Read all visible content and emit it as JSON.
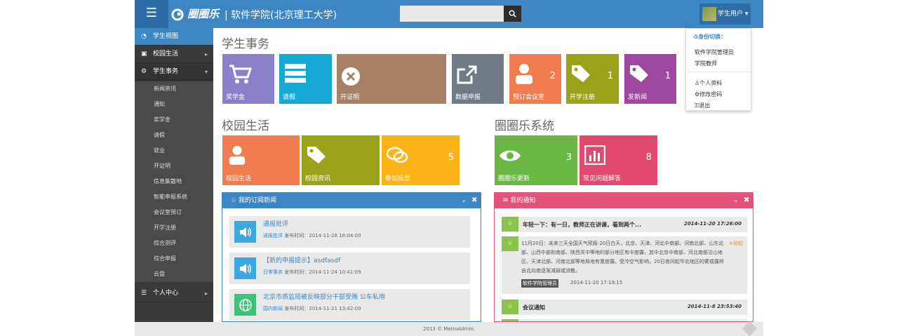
{
  "header": {
    "menu_icon": "☰",
    "logo_text": "圈圈乐",
    "site_title": "| 软件学院(北京理工大学)",
    "search_placeholder": "",
    "search_icon": "search-icon",
    "user_label": "学生用户",
    "user_caret": "▾"
  },
  "dropdown": {
    "heading": "♻身份切换：",
    "role_admin": "软件学院管理员",
    "role_teacher": "学院教师",
    "profile": "个人资料",
    "password": "修改密码",
    "logout": "退出"
  },
  "sidebar": {
    "items": [
      {
        "label": "学生视图",
        "icon": "dashboard-icon"
      },
      {
        "label": "校园生活",
        "icon": "book-icon"
      },
      {
        "label": "学生事务",
        "icon": "gears-icon"
      }
    ],
    "sub_items": [
      "新闻资讯",
      "通知",
      "奖学金",
      "请假",
      "就业",
      "开证明",
      "信息集散地",
      "智能申报系统",
      "会议室预订",
      "开学注册",
      "综合测评",
      "综合申报",
      "云盘"
    ],
    "personal_center": "个人中心"
  },
  "sections": {
    "student_affairs": "学生事务",
    "campus_life": "校园生活",
    "system": "圈圈乐系统"
  },
  "tiles_affairs": [
    {
      "label": "奖学金",
      "count": "",
      "color": "#8a80c9"
    },
    {
      "label": "请假",
      "count": "",
      "color": "#17a9d6"
    },
    {
      "label": "开证明",
      "count": "",
      "color": "#a88065"
    },
    {
      "label": "数据申报",
      "count": "",
      "color": "#707b85"
    },
    {
      "label": "预订会议室",
      "count": "2",
      "color": "#f07c4f"
    },
    {
      "label": "开学注册",
      "count": "1",
      "color": "#9aa21a"
    },
    {
      "label": "发新闻",
      "count": "1",
      "color": "#a048a0"
    }
  ],
  "tiles_campus": [
    {
      "label": "校园生活",
      "count": "",
      "color": "#f07c4f"
    },
    {
      "label": "校园资讯",
      "count": "",
      "color": "#9aa21a"
    },
    {
      "label": "参加投票",
      "count": "5",
      "color": "#fbb317"
    }
  ],
  "tiles_system": [
    {
      "label": "圈圈乐更新",
      "count": "3",
      "color": "#6ab843"
    },
    {
      "label": "常见问题解答",
      "count": "8",
      "color": "#e2496f"
    }
  ],
  "news_panel": {
    "title": "我的订阅新闻",
    "color": "#3c86c4",
    "items": [
      {
        "title": "通报批评",
        "category": "通报批评",
        "time_label": "发布时间：",
        "time": "2014-11-26 16:04:00",
        "icon_color": "#3ca7e0"
      },
      {
        "title": "【新的申报提示】asdfasdf",
        "category": "日常事务",
        "time_label": "发布时间：",
        "time": "2014-11-24 10:41:09",
        "icon_color": "#3ca7e0"
      },
      {
        "title": "北京市质监局被反映部分干部受贿 公车私用",
        "category": "国内新闻",
        "time_label": "发布时间：",
        "time": "2014-11-21 13:42:00",
        "icon_color": "#3ec27a"
      }
    ]
  },
  "notice_panel": {
    "title": "我的通知",
    "color": "#e25477",
    "items": [
      {
        "title": "年轻一下：有一日，教师正在讲课，看到两个...",
        "time": "2014-11-20 17:26:00"
      },
      {
        "body": "11月20日：未来三天全国天气预报-20日白天，北京、天津、河北中南部、河南北部、山东北部、山西中部和南部、陕西关中等地的部分地区有中度霾，其中北京中南部、河北南部沿山地区、天津北部、河南北部等地局地有重度霾。受冷空气影响，20日夜间起华北地区的雾或霾将自北向南逐渐减弱或消散。",
        "collapse": "≡收起",
        "tag": "软件学院管理员",
        "time": "2014-11-20 17:19:15"
      },
      {
        "title": "会议通知",
        "time": "2014-11-8 23:53:40"
      }
    ]
  },
  "footer": {
    "text": "2013 © MetroAdmin."
  }
}
